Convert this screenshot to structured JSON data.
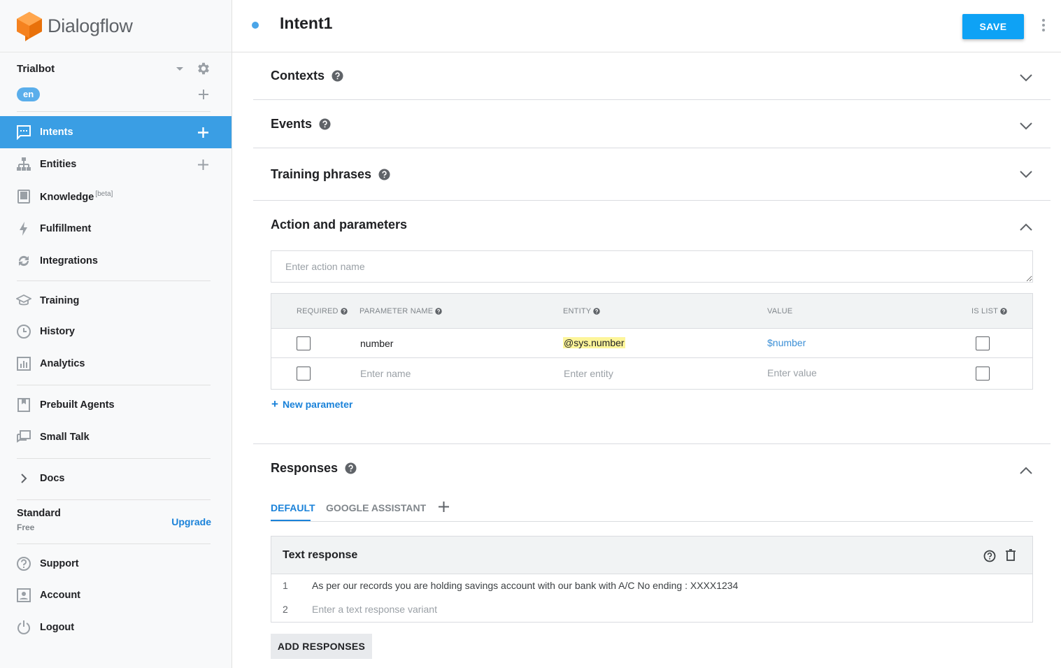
{
  "brand": {
    "name": "Dialogflow"
  },
  "agent": {
    "name": "Trialbot",
    "language": "en"
  },
  "nav": {
    "intents": "Intents",
    "entities": "Entities",
    "knowledge": "Knowledge",
    "knowledge_badge": "[beta]",
    "fulfillment": "Fulfillment",
    "integrations": "Integrations",
    "training": "Training",
    "history": "History",
    "analytics": "Analytics",
    "prebuilt_agents": "Prebuilt Agents",
    "small_talk": "Small Talk",
    "docs": "Docs",
    "support": "Support",
    "account": "Account",
    "logout": "Logout"
  },
  "plan": {
    "name": "Standard",
    "tier": "Free",
    "upgrade_label": "Upgrade"
  },
  "header": {
    "intent_name": "Intent1",
    "save_label": "SAVE"
  },
  "sections": {
    "contexts": "Contexts",
    "events": "Events",
    "training_phrases": "Training phrases",
    "action_parameters": "Action and parameters",
    "responses": "Responses"
  },
  "action": {
    "placeholder": "Enter action name"
  },
  "params": {
    "headers": {
      "required": "REQUIRED",
      "name": "PARAMETER NAME",
      "entity": "ENTITY",
      "value": "VALUE",
      "is_list": "IS LIST"
    },
    "rows": [
      {
        "name": "number",
        "entity": "@sys.number",
        "value": "$number"
      }
    ],
    "placeholders": {
      "name": "Enter name",
      "entity": "Enter entity",
      "value": "Enter value"
    },
    "new_parameter_label": "New parameter"
  },
  "responses": {
    "tabs": [
      "DEFAULT",
      "GOOGLE ASSISTANT"
    ],
    "text_response_title": "Text response",
    "items": [
      "As per our records you are holding savings account with our bank with A/C No ending : XXXX1234"
    ],
    "variant_placeholder": "Enter a text response variant",
    "add_responses_label": "ADD RESPONSES"
  },
  "colors": {
    "accent": "#3a9ee4",
    "save_button": "#0ea2f5",
    "link": "#1a82d9",
    "entity_highlight": "#fdf59a",
    "logo_orange": "#f5821f"
  }
}
